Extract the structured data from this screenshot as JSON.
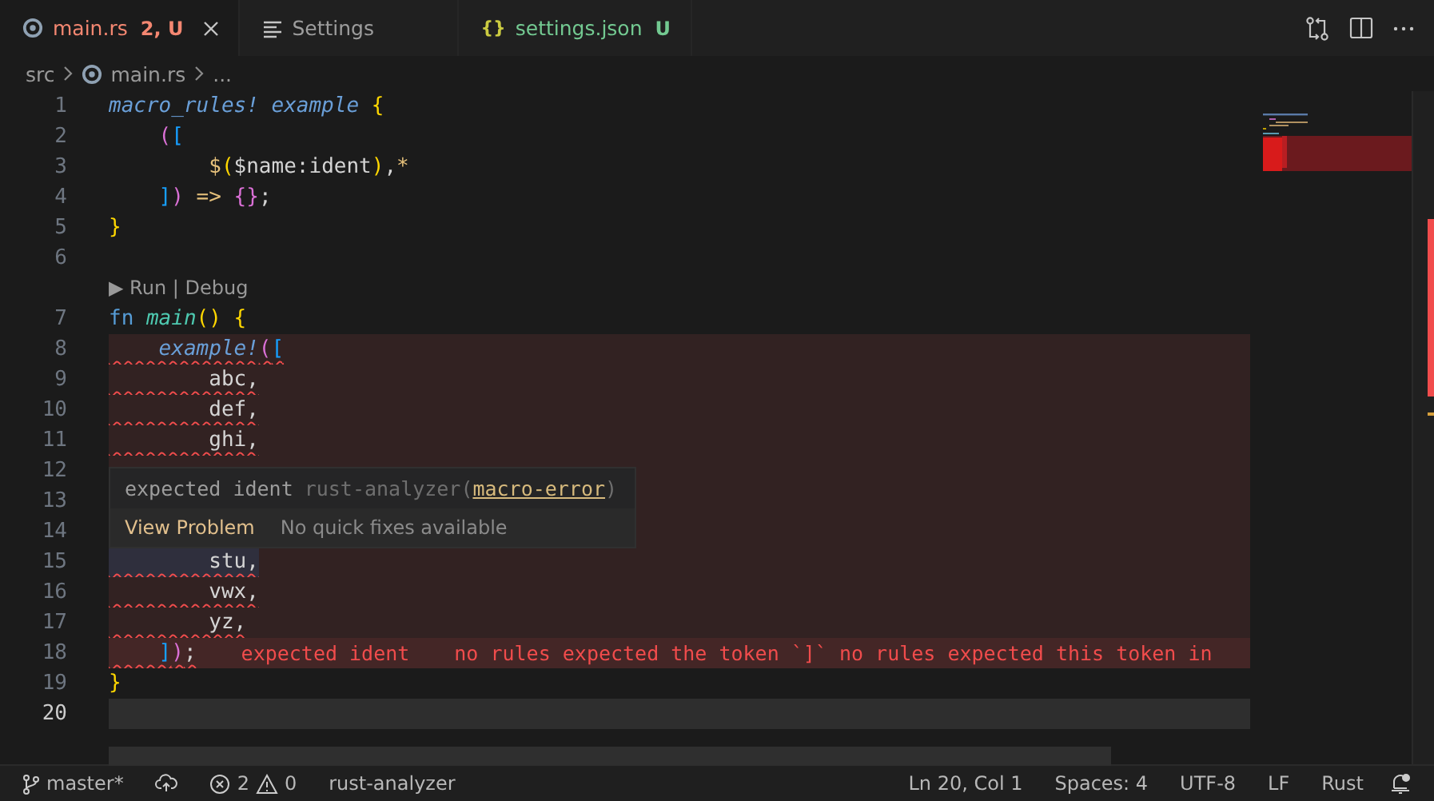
{
  "tabs": [
    {
      "kind": "rust",
      "label": "main.rs",
      "badge": "2, U",
      "color": "#f48771",
      "selected": true
    },
    {
      "kind": "settings",
      "label": "Settings",
      "color": "#9d9d9d",
      "selected": false
    },
    {
      "kind": "json",
      "icon_text": "{}",
      "label": "settings.json",
      "badge": "U",
      "color": "#73c991",
      "selected": false
    }
  ],
  "breadcrumbs": [
    {
      "kind": "folder",
      "label": "src"
    },
    {
      "kind": "rust",
      "label": "main.rs"
    },
    {
      "kind": "more",
      "label": "..."
    }
  ],
  "lines": [
    {
      "number": "1",
      "tokens": [
        {
          "text": "macro_rules! ",
          "kind": "macro"
        },
        {
          "text": "example ",
          "kind": "macro"
        },
        {
          "text": "{",
          "kind": "bracket1"
        }
      ]
    },
    {
      "number": "2",
      "tokens": [
        {
          "text": "    (",
          "kind": "bracket2"
        },
        {
          "text": "[",
          "kind": "bracket3"
        }
      ]
    },
    {
      "number": "3",
      "tokens": [
        {
          "text": "        $",
          "kind": "operator"
        },
        {
          "text": "(",
          "kind": "bracket1"
        },
        {
          "text": "$name:ident",
          "kind": "plain"
        },
        {
          "text": ")",
          "kind": "bracket1"
        },
        {
          "text": ",",
          "kind": "plain"
        },
        {
          "text": "*",
          "kind": "operator"
        }
      ]
    },
    {
      "number": "4",
      "tokens": [
        {
          "text": "    ]",
          "kind": "bracket3"
        },
        {
          "text": ")",
          "kind": "bracket2"
        },
        {
          "text": " => ",
          "kind": "operator"
        },
        {
          "text": "{}",
          "kind": "bracket2"
        },
        {
          "text": ";",
          "kind": "plain"
        }
      ]
    },
    {
      "number": "5",
      "tokens": [
        {
          "text": "}",
          "kind": "bracket1"
        }
      ]
    },
    {
      "number": "6"
    },
    {
      "kind": "codelens",
      "text": "▶ Run | Debug"
    },
    {
      "number": "7",
      "tokens": [
        {
          "text": "fn ",
          "kind": "keyword"
        },
        {
          "text": "main",
          "kind": "function"
        },
        {
          "text": "() {",
          "kind": "bracket1"
        }
      ]
    },
    {
      "number": "8",
      "error": true,
      "squiggle": true,
      "tokens": [
        {
          "text": "    example!",
          "kind": "macro"
        },
        {
          "text": "(",
          "kind": "bracket2"
        },
        {
          "text": "[",
          "kind": "bracket3"
        }
      ]
    },
    {
      "number": "9",
      "error": true,
      "squiggle": true,
      "tokens": [
        {
          "text": "        abc,",
          "kind": "plain"
        }
      ]
    },
    {
      "number": "10",
      "error": true,
      "squiggle": true,
      "tokens": [
        {
          "text": "        def,",
          "kind": "plain"
        }
      ]
    },
    {
      "number": "11",
      "error": true,
      "squiggle": true,
      "tokens": [
        {
          "text": "        ghi,",
          "kind": "plain"
        }
      ]
    },
    {
      "number": "12",
      "error": true
    },
    {
      "number": "13",
      "error": true
    },
    {
      "number": "14",
      "error": true
    },
    {
      "number": "15",
      "error": true,
      "squiggle": true,
      "highlighted": true,
      "tokens": [
        {
          "text": "        stu,",
          "kind": "plain"
        }
      ]
    },
    {
      "number": "16",
      "error": true,
      "squiggle": true,
      "tokens": [
        {
          "text": "        vwx,",
          "kind": "plain"
        }
      ]
    },
    {
      "number": "17",
      "error": true,
      "squiggle": true,
      "tokens": [
        {
          "text": "        yz,",
          "kind": "plain"
        }
      ]
    },
    {
      "number": "18",
      "error": true,
      "squiggle": true,
      "tokens": [
        {
          "text": "    ]",
          "kind": "bracket3"
        },
        {
          "text": ")",
          "kind": "bracket2"
        },
        {
          "text": ";",
          "kind": "plain"
        }
      ],
      "inline_errors": [
        "expected ident",
        "no rules expected the token `]` no rules expected this token in"
      ]
    },
    {
      "number": "19",
      "tokens": [
        {
          "text": "}",
          "kind": "bracket1"
        }
      ]
    },
    {
      "number": "20",
      "current": true
    }
  ],
  "hover": {
    "message": "expected ident",
    "source": "rust-analyzer(",
    "code": "macro-error",
    "source_end": ")",
    "action": "View Problem",
    "note": "No quick fixes available"
  },
  "status_bar": {
    "branch": "master*",
    "errors": "2",
    "warnings": "0",
    "items_left": [
      "rust-analyzer"
    ],
    "items_right": [
      "Ln 20, Col 1",
      "Spaces: 4",
      "UTF-8",
      "LF",
      "Rust"
    ]
  }
}
